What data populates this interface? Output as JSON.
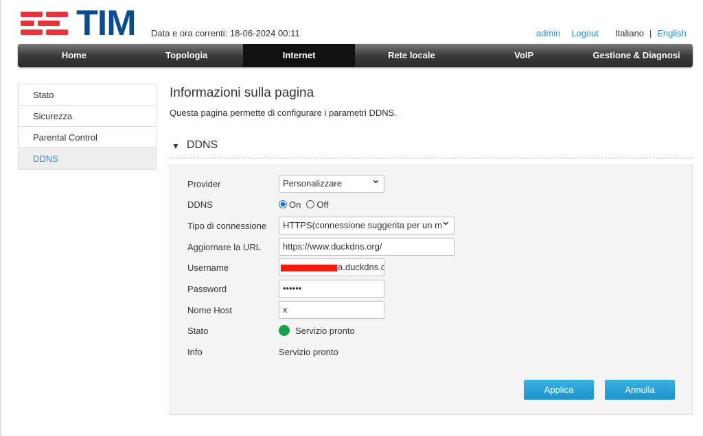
{
  "header": {
    "logo_text": "TIM",
    "datetime": "Data e ora correnti: 18-06-2024 00:11",
    "user": "admin",
    "logout": "Logout",
    "lang_it": "Italiano",
    "lang_sep": "|",
    "lang_en": "English"
  },
  "nav": [
    {
      "label": "Home"
    },
    {
      "label": "Topologia"
    },
    {
      "label": "Internet",
      "active": true
    },
    {
      "label": "Rete locale"
    },
    {
      "label": "VoIP"
    },
    {
      "label": "Gestione & Diagnosi"
    }
  ],
  "sidebar": [
    {
      "label": "Stato"
    },
    {
      "label": "Sicurezza"
    },
    {
      "label": "Parental Control"
    },
    {
      "label": "DDNS",
      "active": true
    }
  ],
  "page": {
    "title": "Informazioni sulla pagina",
    "description": "Questa pagina permette di configurare i parametri DDNS.",
    "section": "DDNS",
    "section_icon": "triangle-down"
  },
  "form": {
    "provider_label": "Provider",
    "provider_value": "Personalizzare",
    "ddns_label": "DDNS",
    "ddns_on": "On",
    "ddns_off": "Off",
    "ddns_selected": "On",
    "conn_label": "Tipo di connessione",
    "conn_value": "HTTPS(connessione suggerita per un m",
    "url_label": "Aggiornare la URL",
    "url_value": "https://www.duckdns.org/",
    "user_label": "Username",
    "user_value": "a.duckdns.c",
    "pass_label": "Password",
    "pass_value": "••••••",
    "host_label": "Nome Host",
    "host_value": "x",
    "stato_label": "Stato",
    "stato_value": "Servizio pronto",
    "stato_color": "#17a24a",
    "info_label": "Info",
    "info_value": "Servizio pronto",
    "apply": "Applica",
    "cancel": "Annulla"
  }
}
